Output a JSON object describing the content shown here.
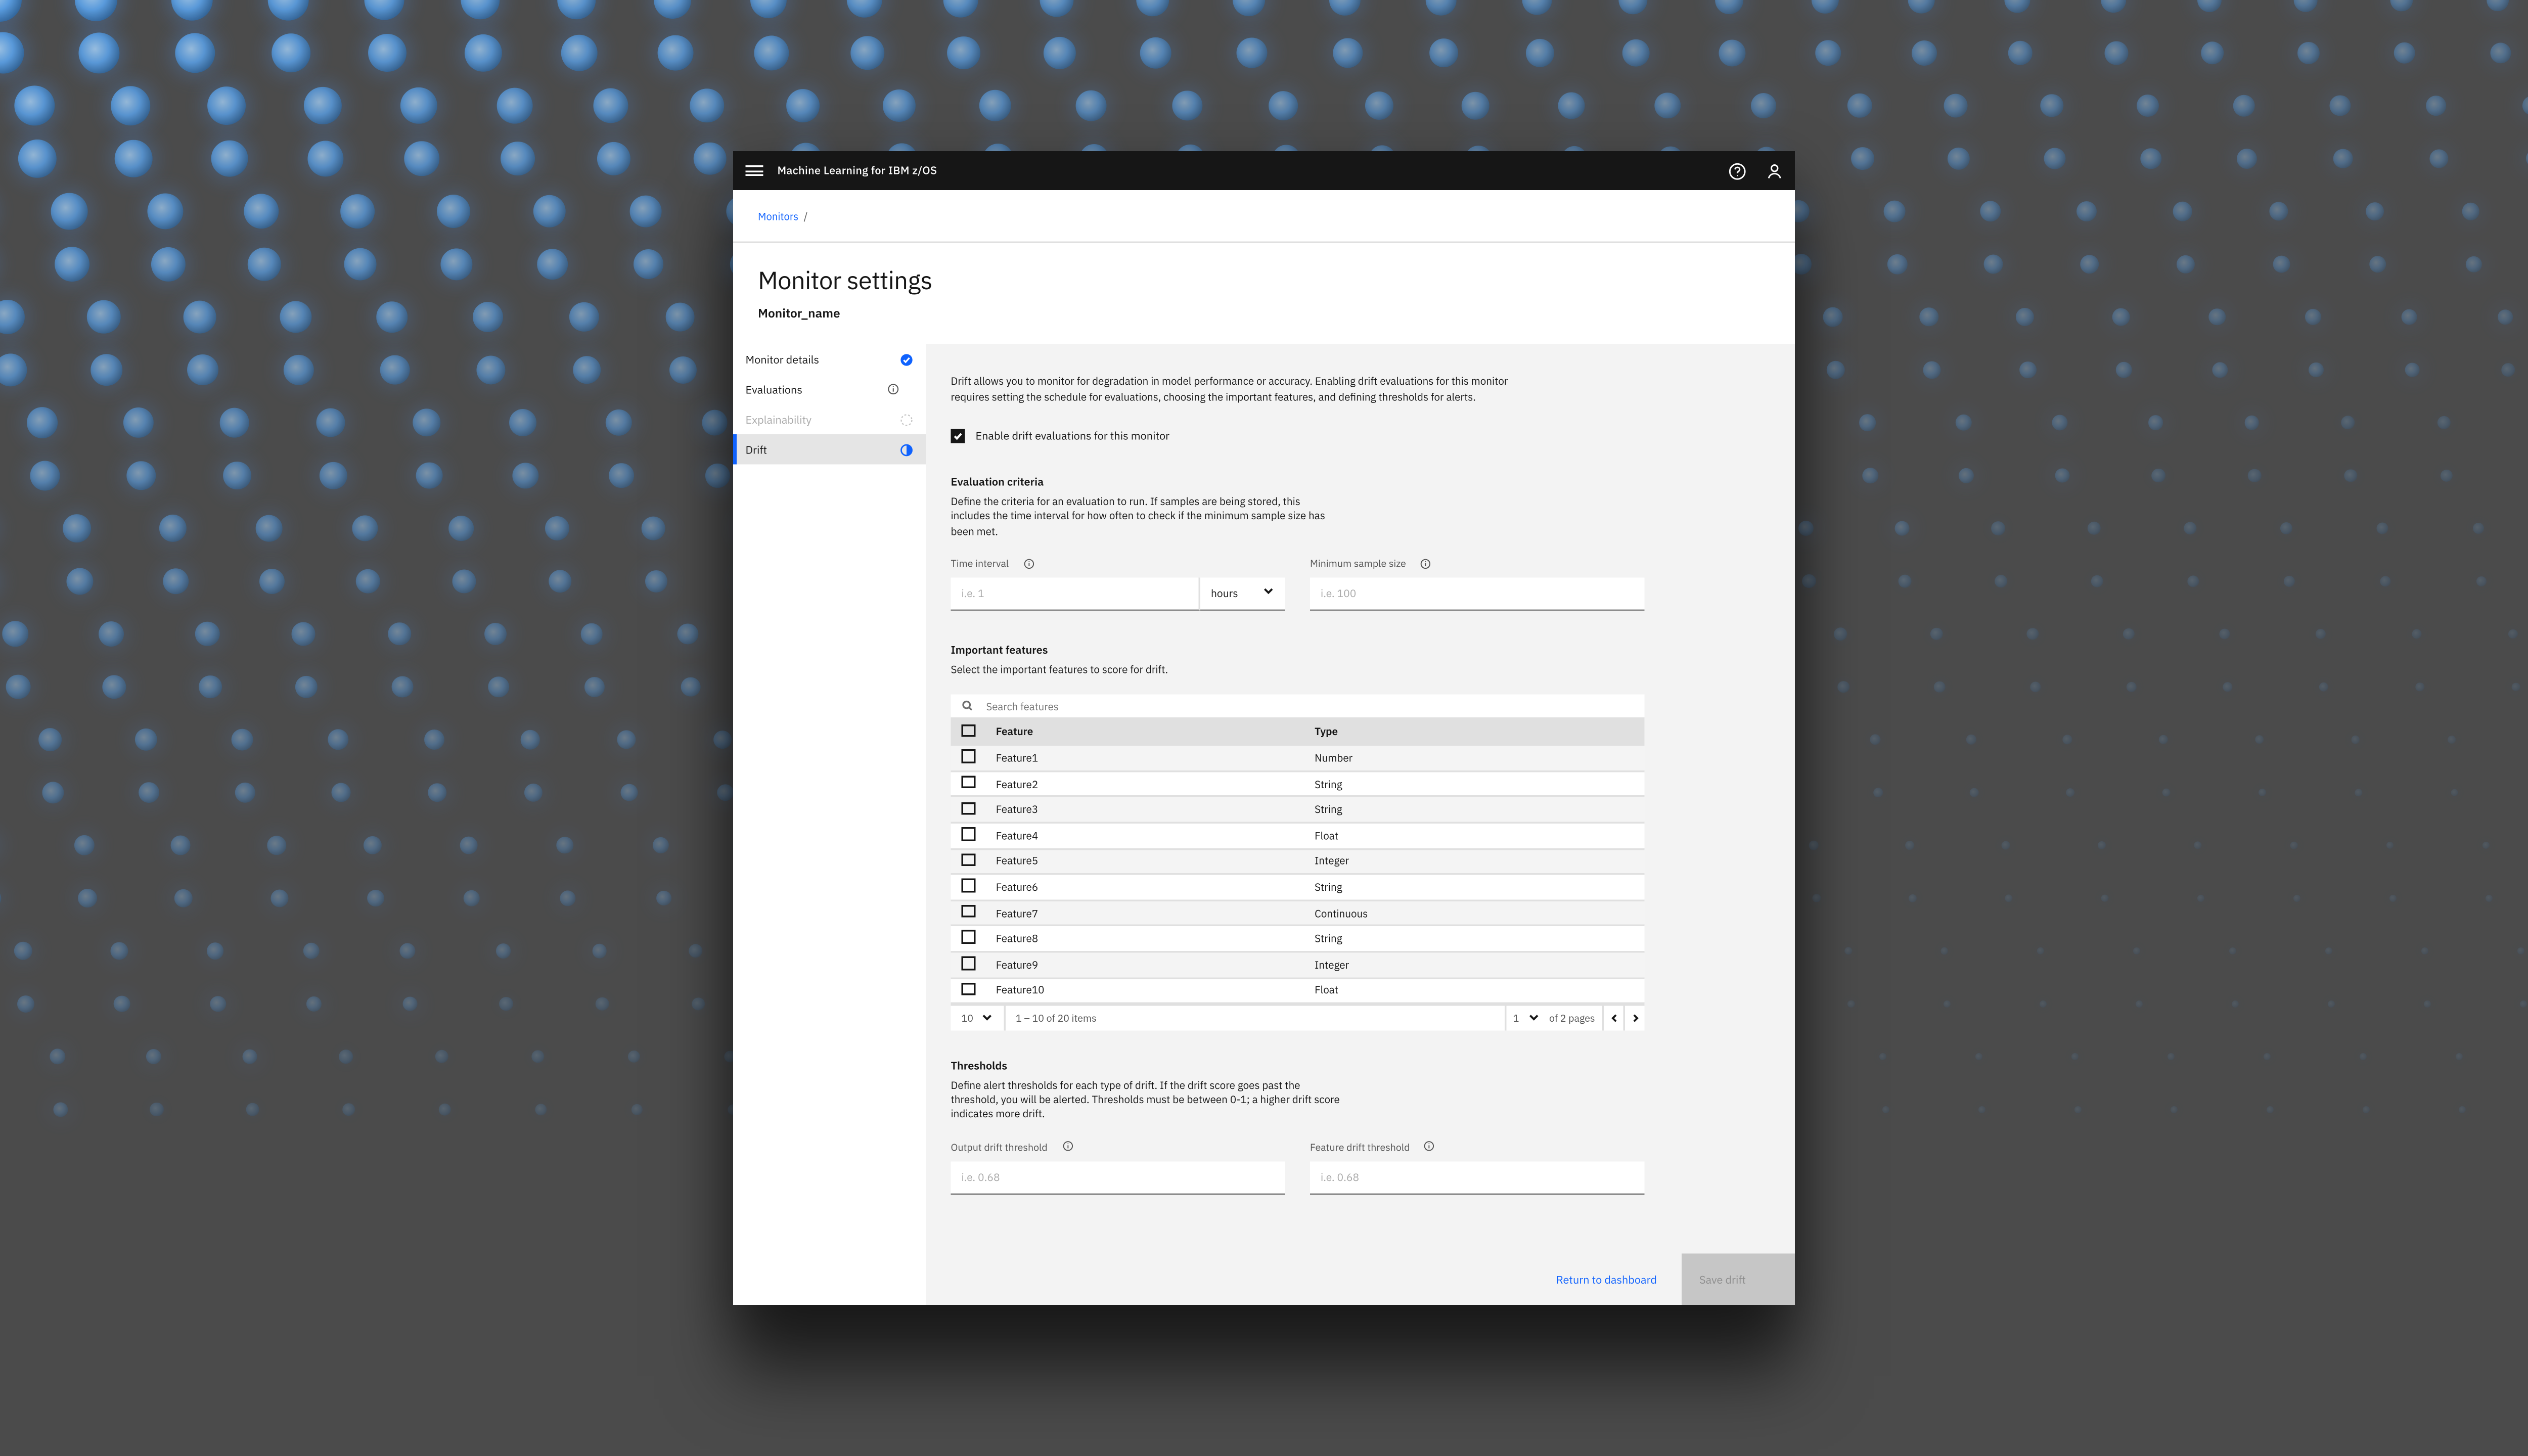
{
  "header": {
    "product": "Machine Learning for IBM z/OS"
  },
  "breadcrumb": {
    "root": "Monitors",
    "sep": "/"
  },
  "title": {
    "heading": "Monitor settings",
    "sub": "Monitor_name"
  },
  "sidebar": {
    "items": [
      {
        "label": "Monitor details",
        "status": "complete",
        "info": false,
        "active": false,
        "dim": false
      },
      {
        "label": "Evaluations",
        "status": "none",
        "info": true,
        "active": false,
        "dim": false
      },
      {
        "label": "Explainability",
        "status": "pending",
        "info": false,
        "active": false,
        "dim": true
      },
      {
        "label": "Drift",
        "status": "inprog",
        "info": false,
        "active": true,
        "dim": false
      }
    ]
  },
  "drift": {
    "description": "Drift allows you to monitor for degradation in model performance or accuracy. Enabling drift evaluations for this monitor requires setting the schedule for evaluations, choosing the important features, and defining thresholds for alerts.",
    "enable_label": "Enable drift evaluations for this monitor",
    "enable_checked": true,
    "evaluation": {
      "heading": "Evaluation criteria",
      "desc": "Define the criteria for an evaluation to run. If samples are being stored, this includes the time interval for how often to check if the minimum sample size has been met.",
      "time_interval_label": "Time interval",
      "time_interval_placeholder": "i.e. 1",
      "time_unit": "hours",
      "min_sample_label": "Minimum sample size",
      "min_sample_placeholder": "i.e. 100"
    },
    "features": {
      "heading": "Important features",
      "desc": "Select the important features to score for drift.",
      "search_placeholder": "Search features",
      "columns": {
        "feature": "Feature",
        "type": "Type"
      },
      "rows": [
        {
          "feature": "Feature1",
          "type": "Number"
        },
        {
          "feature": "Feature2",
          "type": "String"
        },
        {
          "feature": "Feature3",
          "type": "String"
        },
        {
          "feature": "Feature4",
          "type": "Float"
        },
        {
          "feature": "Feature5",
          "type": "Integer"
        },
        {
          "feature": "Feature6",
          "type": "String"
        },
        {
          "feature": "Feature7",
          "type": "Continuous"
        },
        {
          "feature": "Feature8",
          "type": "String"
        },
        {
          "feature": "Feature9",
          "type": "Integer"
        },
        {
          "feature": "Feature10",
          "type": "Float"
        }
      ],
      "pager": {
        "per_page": "10",
        "range": "1 – 10 of 20 items",
        "page": "1",
        "of_pages": "of 2 pages"
      }
    },
    "thresholds": {
      "heading": "Thresholds",
      "desc": "Define alert thresholds for each type of drift. If the drift score goes past the threshold, you will be alerted. Thresholds must be between 0-1; a higher drift score indicates more drift.",
      "output_label": "Output drift threshold",
      "output_placeholder": "i.e. 0.68",
      "feature_label": "Feature drift threshold",
      "feature_placeholder": "i.e. 0.68"
    }
  },
  "footer": {
    "return": "Return to dashboard",
    "save": "Save drift"
  }
}
